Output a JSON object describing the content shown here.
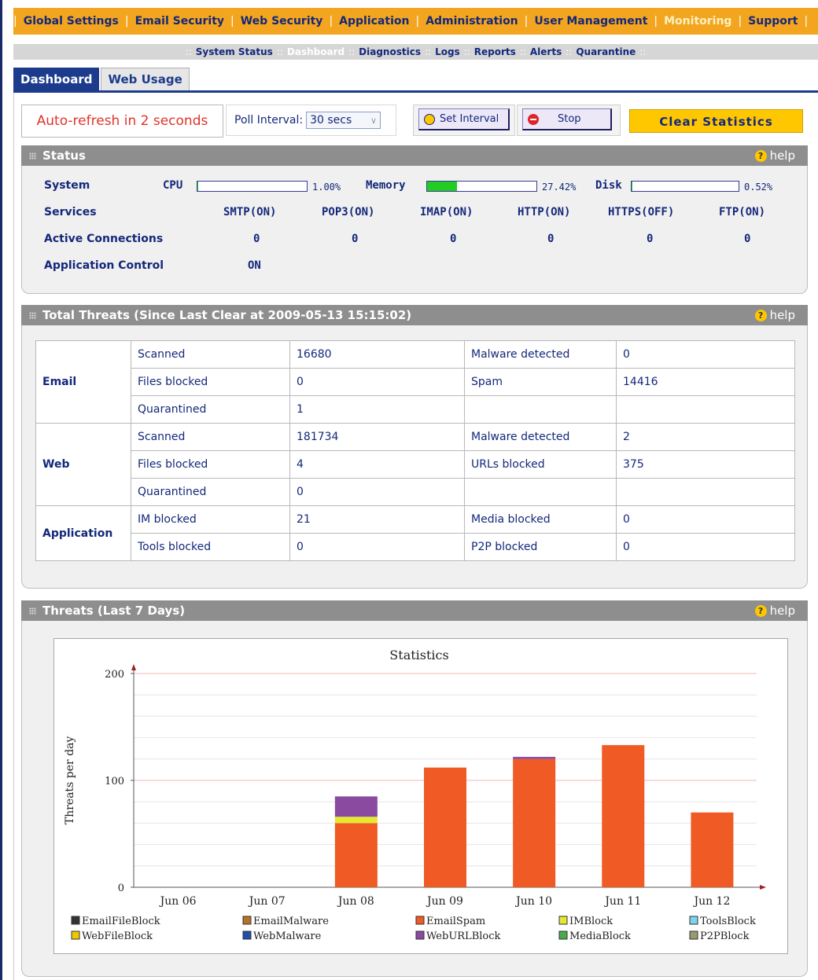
{
  "topnav": {
    "items": [
      "Global Settings",
      "Email Security",
      "Web Security",
      "Application",
      "Administration",
      "User Management",
      "Monitoring",
      "Support"
    ],
    "active": "Monitoring"
  },
  "subnav": {
    "items": [
      "System Status",
      "Dashboard",
      "Diagnostics",
      "Logs",
      "Reports",
      "Alerts",
      "Quarantine"
    ],
    "active": "Dashboard"
  },
  "tabs": [
    "Dashboard",
    "Web Usage"
  ],
  "controls": {
    "autorefresh": "Auto-refresh in 2 seconds",
    "poll_label": "Poll Interval:",
    "poll_value": "30 secs",
    "set_interval": "Set Interval",
    "stop": "Stop",
    "clear": "Clear Statistics"
  },
  "status": {
    "title": "Status",
    "help": "help",
    "system_label": "System",
    "cpu_label": "CPU",
    "cpu_pct": "1.00%",
    "cpu_value": 1.0,
    "memory_label": "Memory",
    "memory_pct": "27.42%",
    "memory_value": 27.42,
    "disk_label": "Disk",
    "disk_pct": "0.52%",
    "disk_value": 0.52,
    "services_label": "Services",
    "services": [
      "SMTP(ON)",
      "POP3(ON)",
      "IMAP(ON)",
      "HTTP(ON)",
      "HTTPS(OFF)",
      "FTP(ON)"
    ],
    "active_label": "Active Connections",
    "active": [
      "0",
      "0",
      "0",
      "0",
      "0",
      "0"
    ],
    "appctl_label": "Application Control",
    "appctl": "ON"
  },
  "threats": {
    "title": "Total Threats (Since Last Clear at 2009-05-13 15:15:02)",
    "help": "help",
    "email_label": "Email",
    "web_label": "Web",
    "app_label": "Application",
    "email": [
      [
        "Scanned",
        "16680",
        "Malware detected",
        "0"
      ],
      [
        "Files blocked",
        "0",
        "Spam",
        "14416"
      ],
      [
        "Quarantined",
        "1",
        "",
        ""
      ]
    ],
    "web": [
      [
        "Scanned",
        "181734",
        "Malware detected",
        "2"
      ],
      [
        "Files blocked",
        "4",
        "URLs blocked",
        "375"
      ],
      [
        "Quarantined",
        "0",
        "",
        ""
      ]
    ],
    "app": [
      [
        "IM blocked",
        "21",
        "Media blocked",
        "0"
      ],
      [
        "Tools blocked",
        "0",
        "P2P blocked",
        "0"
      ]
    ]
  },
  "last7": {
    "title": "Threats (Last 7 Days)",
    "help": "help"
  },
  "chart_data": {
    "type": "bar",
    "stacked": true,
    "title": "Statistics",
    "ylabel": "Threats per day",
    "xlabel": "",
    "ylim": [
      0,
      200
    ],
    "yticks": [
      0,
      100,
      200
    ],
    "categories": [
      "Jun 06",
      "Jun 07",
      "Jun 08",
      "Jun 09",
      "Jun 10",
      "Jun 11",
      "Jun 12"
    ],
    "series": [
      {
        "name": "EmailFileBlock",
        "color": "#333333",
        "values": [
          0,
          0,
          0,
          0,
          0,
          0,
          0
        ]
      },
      {
        "name": "EmailMalware",
        "color": "#b8702a",
        "values": [
          0,
          0,
          0,
          0,
          0,
          0,
          0
        ]
      },
      {
        "name": "EmailSpam",
        "color": "#f05a24",
        "values": [
          0,
          0,
          60,
          112,
          120,
          133,
          70
        ]
      },
      {
        "name": "IMBlock",
        "color": "#e4e830",
        "values": [
          0,
          0,
          6,
          0,
          0,
          0,
          0
        ]
      },
      {
        "name": "ToolsBlock",
        "color": "#7dd3f0",
        "values": [
          0,
          0,
          0,
          0,
          0,
          0,
          0
        ]
      },
      {
        "name": "WebFileBlock",
        "color": "#f0c800",
        "values": [
          0,
          0,
          0,
          0,
          0,
          0,
          0
        ]
      },
      {
        "name": "WebMalware",
        "color": "#1f4fa8",
        "values": [
          0,
          0,
          0,
          0,
          0,
          0,
          0
        ]
      },
      {
        "name": "WebURLBlock",
        "color": "#8a4aa0",
        "values": [
          0,
          0,
          19,
          0,
          2,
          0,
          0
        ]
      },
      {
        "name": "MediaBlock",
        "color": "#4aaa4a",
        "values": [
          0,
          0,
          0,
          0,
          0,
          0,
          0
        ]
      },
      {
        "name": "P2PBlock",
        "color": "#9a9a70",
        "values": [
          0,
          0,
          0,
          0,
          0,
          0,
          0
        ]
      }
    ],
    "grid": true,
    "legend": "bottom"
  }
}
